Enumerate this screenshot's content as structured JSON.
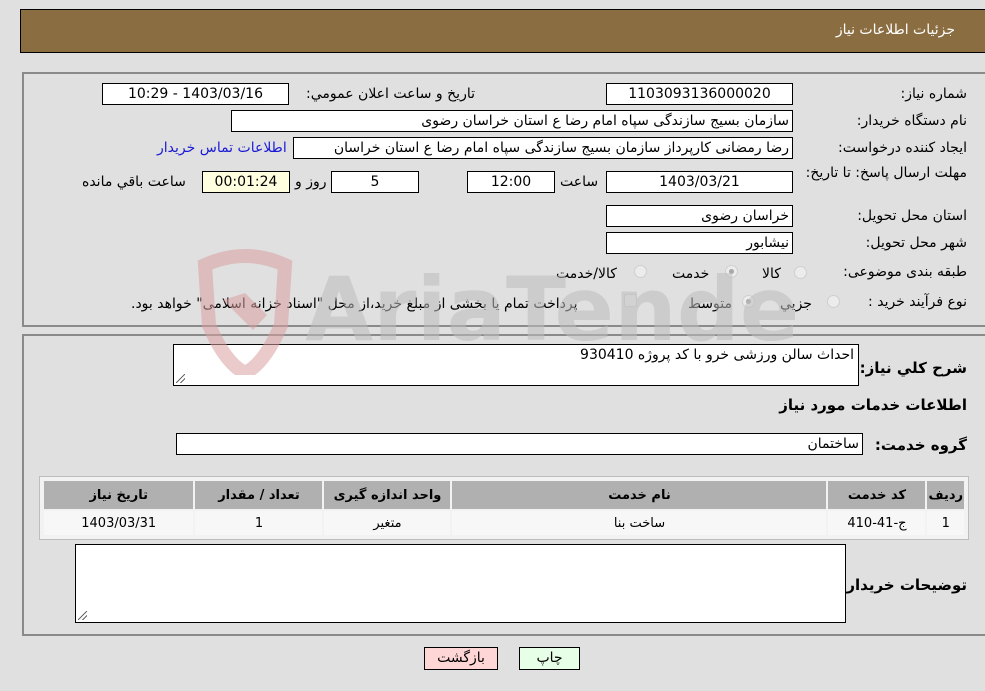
{
  "header": {
    "title": "جزئیات اطلاعات نیاز"
  },
  "form": {
    "need_number_label": "شماره نیاز:",
    "need_number": "1103093136000020",
    "announce_label": "تاريخ و ساعت اعلان عمومي:",
    "announce_value": "1403/03/16 - 10:29",
    "buyer_org_label": "نام دستگاه خریدار:",
    "buyer_org": "سازمان بسیج سازندگی سپاه امام رضا  ع  استان خراسان رضوی",
    "creator_label": "ایجاد کننده درخواست:",
    "creator": "رضا رمضانی کارپرداز سازمان بسیج سازندگی سپاه امام رضا  ع  استان خراسان",
    "buyer_contact_link": "اطلاعات تماس خریدار",
    "deadline_label": "مهلت ارسال پاسخ: تا تاریخ:",
    "deadline_date": "1403/03/21",
    "time_label": "ساعت",
    "deadline_time": "12:00",
    "days_value": "5",
    "days_label": "روز و",
    "remaining_time": "00:01:24",
    "remaining_label": "ساعت باقي مانده",
    "province_label": "استان محل تحویل:",
    "province": "خراسان رضوی",
    "city_label": "شهر محل تحویل:",
    "city": "نیشابور",
    "category_label": "طبقه بندی موضوعی:",
    "category_options": [
      {
        "label": "کالا",
        "checked": false
      },
      {
        "label": "خدمت",
        "checked": true
      },
      {
        "label": "کالا/خدمت",
        "checked": false
      }
    ],
    "process_label": "نوع فرآیند خرید :",
    "process_options": [
      {
        "label": "جزيي",
        "checked": false
      },
      {
        "label": "متوسط",
        "checked": true
      }
    ],
    "treasury_note": "پرداخت تمام یا بخشی از مبلغ خرید،از محل \"اسناد خزانه اسلامی\" خواهد بود.",
    "treasury_checked": false
  },
  "details": {
    "summary_label": "شرح کلي نياز:",
    "summary_value": "احداث سالن ورزشی خرو با کد پروژه 930410",
    "services_heading": "اطلاعات خدمات مورد نیاز",
    "service_group_label": "گروه خدمت:",
    "service_group": "ساختمان",
    "table": {
      "headers": [
        "ردیف",
        "کد خدمت",
        "نام خدمت",
        "واحد اندازه گیری",
        "تعداد / مقدار",
        "تاریخ نیاز"
      ],
      "rows": [
        [
          "1",
          "ج-41-410",
          "ساخت بنا",
          "متغیر",
          "1",
          "1403/03/31"
        ]
      ]
    },
    "buyer_notes_label": "توضیحات خریدار:",
    "buyer_notes": ""
  },
  "buttons": {
    "print": "چاپ",
    "back": "بازگشت"
  },
  "watermark": {
    "text": "AriaTender.neT"
  }
}
